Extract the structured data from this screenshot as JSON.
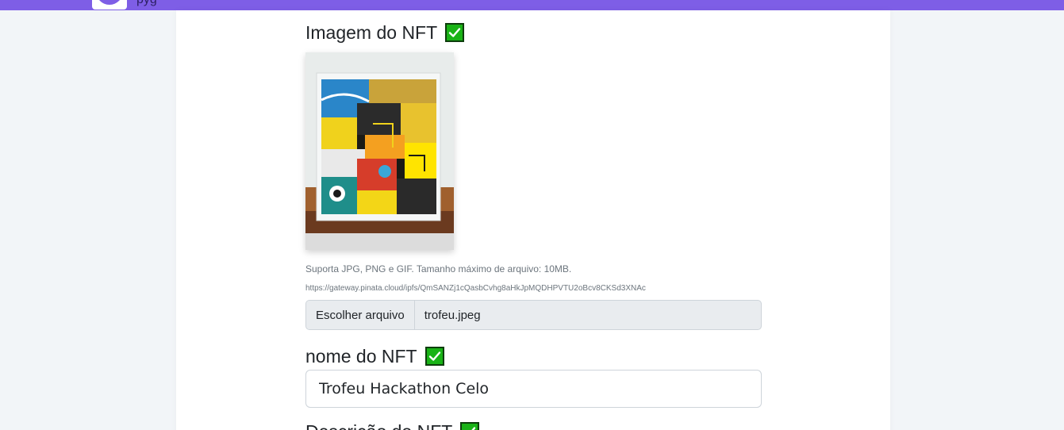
{
  "header": {
    "title_fragment": "pyg",
    "accent_color": "#7e5ee6"
  },
  "form": {
    "image_section": {
      "label": "Imagem do NFT",
      "status_icon": "green-checkmark-icon",
      "help_text": "Suporta JPG, PNG e GIF. Tamanho máximo de arquivo: 10MB.",
      "ipfs_url": "https://gateway.pinata.cloud/ipfs/QmSANZj1cQasbCvhg8aHkJpMQDHPVTU2oBcv8CKSd3XNAc",
      "file_button_label": "Escolher arquivo",
      "file_name": "trofeu.jpeg"
    },
    "name_section": {
      "label": "nome do NFT",
      "status_icon": "green-checkmark-icon",
      "value": "Trofeu Hackathon Celo"
    },
    "description_section": {
      "label": "Descrição do NFT",
      "status_icon": "green-checkmark-icon"
    }
  },
  "colors": {
    "check_green": "#19b316",
    "page_background": "#f2f5f8"
  }
}
